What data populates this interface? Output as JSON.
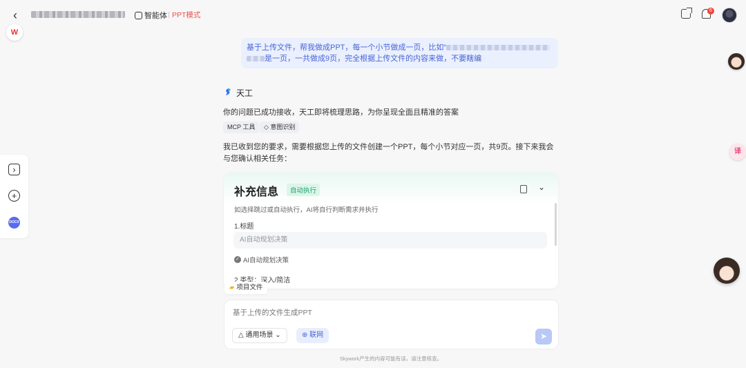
{
  "header": {
    "back_icon": "chevron-left-icon",
    "agent_label": "智能体",
    "mode_label": "PPT模式",
    "mode_color": "#e8534b",
    "logo_text": "W",
    "notification_count": "6"
  },
  "right_floaters": {
    "translate_label": "译"
  },
  "left_toolbar": {
    "items": [
      "expand-sidebar-icon",
      "new-chat-icon",
      "docx-icon"
    ],
    "docx_label": "DOCX"
  },
  "user_message": {
    "line1_prefix": "基于上传文件，帮我做成PPT，每一个小节做成一页，比如“",
    "line2_suffix": "是一页，一共做成9页，完全根据上传文件的内容来做，不要瞎编"
  },
  "assistant": {
    "name": "天工",
    "reply1": "你的问题已成功接收，天工即将梳理思路，为你呈现全面且精准的答案",
    "chips": [
      "MCP 工具",
      "意图识别"
    ],
    "reply2": "我已收到您的要求，需要根据您上传的文件创建一个PPT，每个小节对应一页，共9页。接下来我会与您确认相关任务："
  },
  "card": {
    "title": "补充信息",
    "badge": "自动执行",
    "badge_color": "#17a36b",
    "description": "如选择跳过或自动执行，AI将自行判断需求并执行",
    "q1_label": "1.标题",
    "q1_placeholder": "AI自动规划决策",
    "q1_check": "AI自动规划决策",
    "q2_label": "2.类型：深入/简洁"
  },
  "project_files": {
    "label": "项目文件"
  },
  "composer": {
    "placeholder": "基于上传的文件生成PPT",
    "scene_label": "通用场景",
    "web_label": "联网",
    "accent_color": "#4a66d6"
  },
  "footer": {
    "disclaimer": "Skywork产生的内容可能有误，请注意核查。"
  }
}
